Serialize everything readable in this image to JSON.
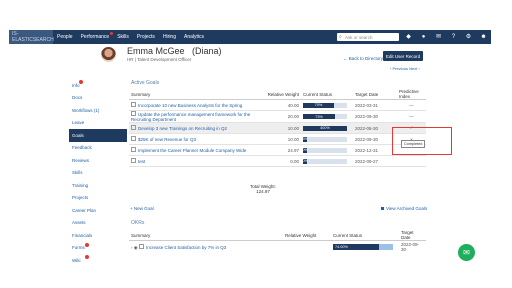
{
  "nav": {
    "logo": "IS-ELASTICSEARCH",
    "items": [
      "People",
      "Performance",
      "Skills",
      "Projects",
      "Hiring",
      "Analytics"
    ],
    "search_placeholder": "Ask or search",
    "icons": [
      "mortarboard-icon",
      "bell-icon",
      "mail-icon",
      "help-icon",
      "gear-icon",
      "user-icon"
    ]
  },
  "header": {
    "name": "Emma McGee",
    "nickname": "(Diana)",
    "title": "HR | Talent Development Officer",
    "back_label": "← Back to Directory",
    "edit_label": "Edit User Record",
    "pager": "‹ Previous   Next ›"
  },
  "sidebar": [
    {
      "label": "Info"
    },
    {
      "label": "Docs"
    },
    {
      "label": "Workflows (1)"
    },
    {
      "label": "Leave"
    },
    {
      "label": "Goals",
      "active": true
    },
    {
      "label": "Feedback"
    },
    {
      "label": "Reviews"
    },
    {
      "label": "Skills"
    },
    {
      "label": "Training"
    },
    {
      "label": "Projects"
    },
    {
      "label": "Career Plan"
    },
    {
      "label": "Assets"
    },
    {
      "label": "Financials"
    },
    {
      "label": "Forms"
    },
    {
      "label": "Wiki"
    }
  ],
  "goals": {
    "section_title": "Active Goals",
    "columns": [
      "Summary",
      "Relative Weight",
      "Current Status",
      "Target Date",
      "Predictive Index"
    ],
    "rows": [
      {
        "summary": "Incorporate 10 new Business Analysts for the Spring",
        "weight": "40.00",
        "status": "70%",
        "pct": 0.7,
        "date": "2022-03-31",
        "pi": "—"
      },
      {
        "summary": "Update the performance management framework for the Recruiting Department",
        "weight": "20.00",
        "status": "73%",
        "pct": 0.73,
        "date": "2022-09-30",
        "pi": "—"
      },
      {
        "summary": "Develop 3 new Trainings on Recruiting in Q2",
        "weight": "10.00",
        "status": "400%",
        "pct": 1.0,
        "date": "2022-06-30",
        "pi": "✓",
        "highlight": true
      },
      {
        "summary": "$25K of new Revenue for Q3",
        "weight": "10.00",
        "status": "3%",
        "pct": 0.03,
        "date": "2022-09-30",
        "pi": "×"
      },
      {
        "summary": "Implement the Career Planner Module Company Wide",
        "weight": "24.97",
        "status": "0%",
        "pct": 0.0,
        "date": "2022-12-31",
        "pi": ""
      },
      {
        "summary": "test",
        "weight": "0.00",
        "status": "0%",
        "pct": 0.0,
        "date": "2022-09-27",
        "pi": ""
      }
    ],
    "total_label": "Total Weight:",
    "total_value": "124.97",
    "tooltip": "Completed",
    "new_goal": "+ New Goal",
    "view_archived": "View Archived Goals"
  },
  "okrs": {
    "section_title": "OKRs",
    "columns": [
      "Summary",
      "Relative Weight",
      "Current Status",
      "Target Date"
    ],
    "rows": [
      {
        "summary": "Increase Client Satisfaction by 7% in Q3",
        "weight": "",
        "status": "74.00%",
        "pct": 0.74,
        "date": "2022-09-30"
      }
    ]
  }
}
